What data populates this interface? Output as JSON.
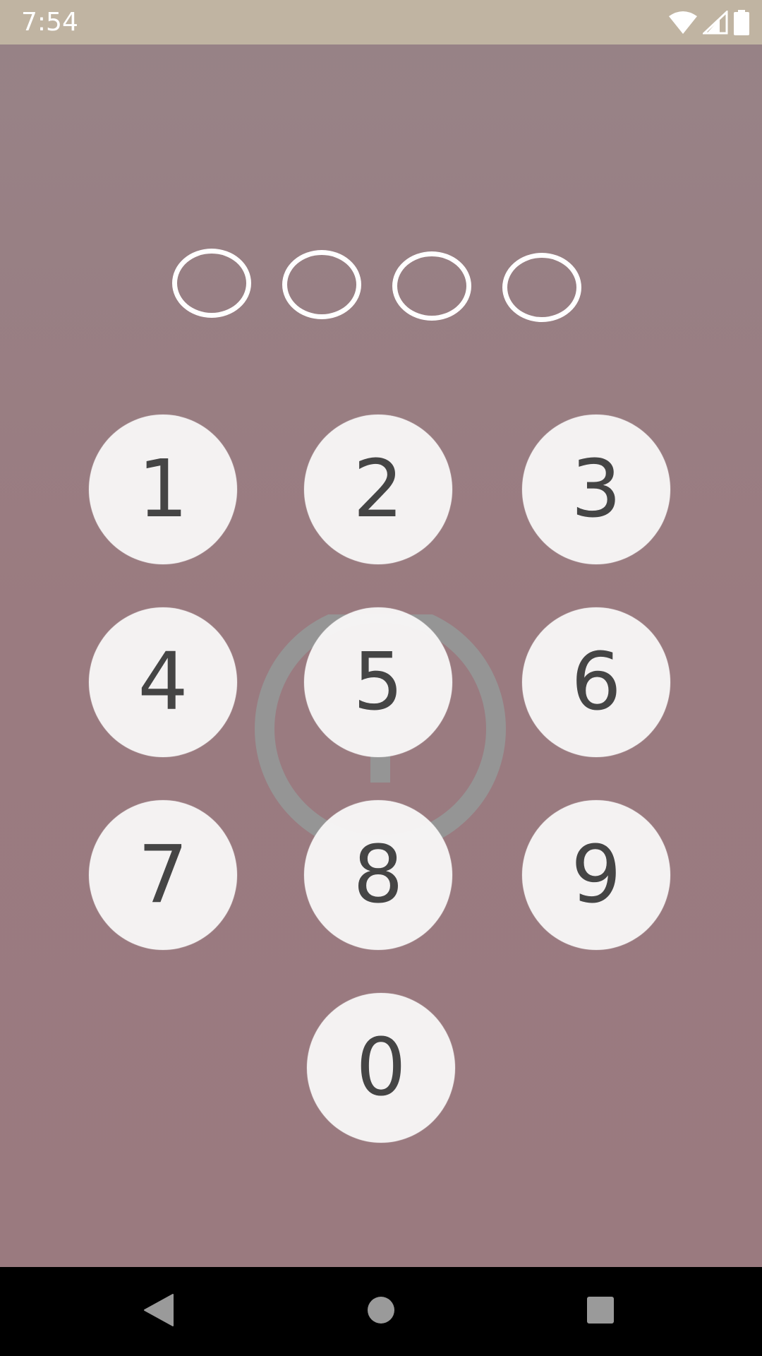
{
  "status_bar": {
    "time": "7:54",
    "icons": [
      "wifi-icon",
      "signal-icon",
      "battery-icon"
    ],
    "background": "#c0b4a2"
  },
  "pin": {
    "length": 4,
    "entered": 0
  },
  "keypad": {
    "keys": [
      "1",
      "2",
      "3",
      "4",
      "5",
      "6",
      "7",
      "8",
      "9",
      "0"
    ]
  },
  "watermark_icon": "lock-icon",
  "nav_bar": {
    "buttons": [
      "back-icon",
      "home-icon",
      "recents-icon"
    ]
  },
  "colors": {
    "background": "#9a7b80",
    "key_fill": "#f6f5f5",
    "key_text": "#454545",
    "dot_outline": "#ffffff"
  }
}
